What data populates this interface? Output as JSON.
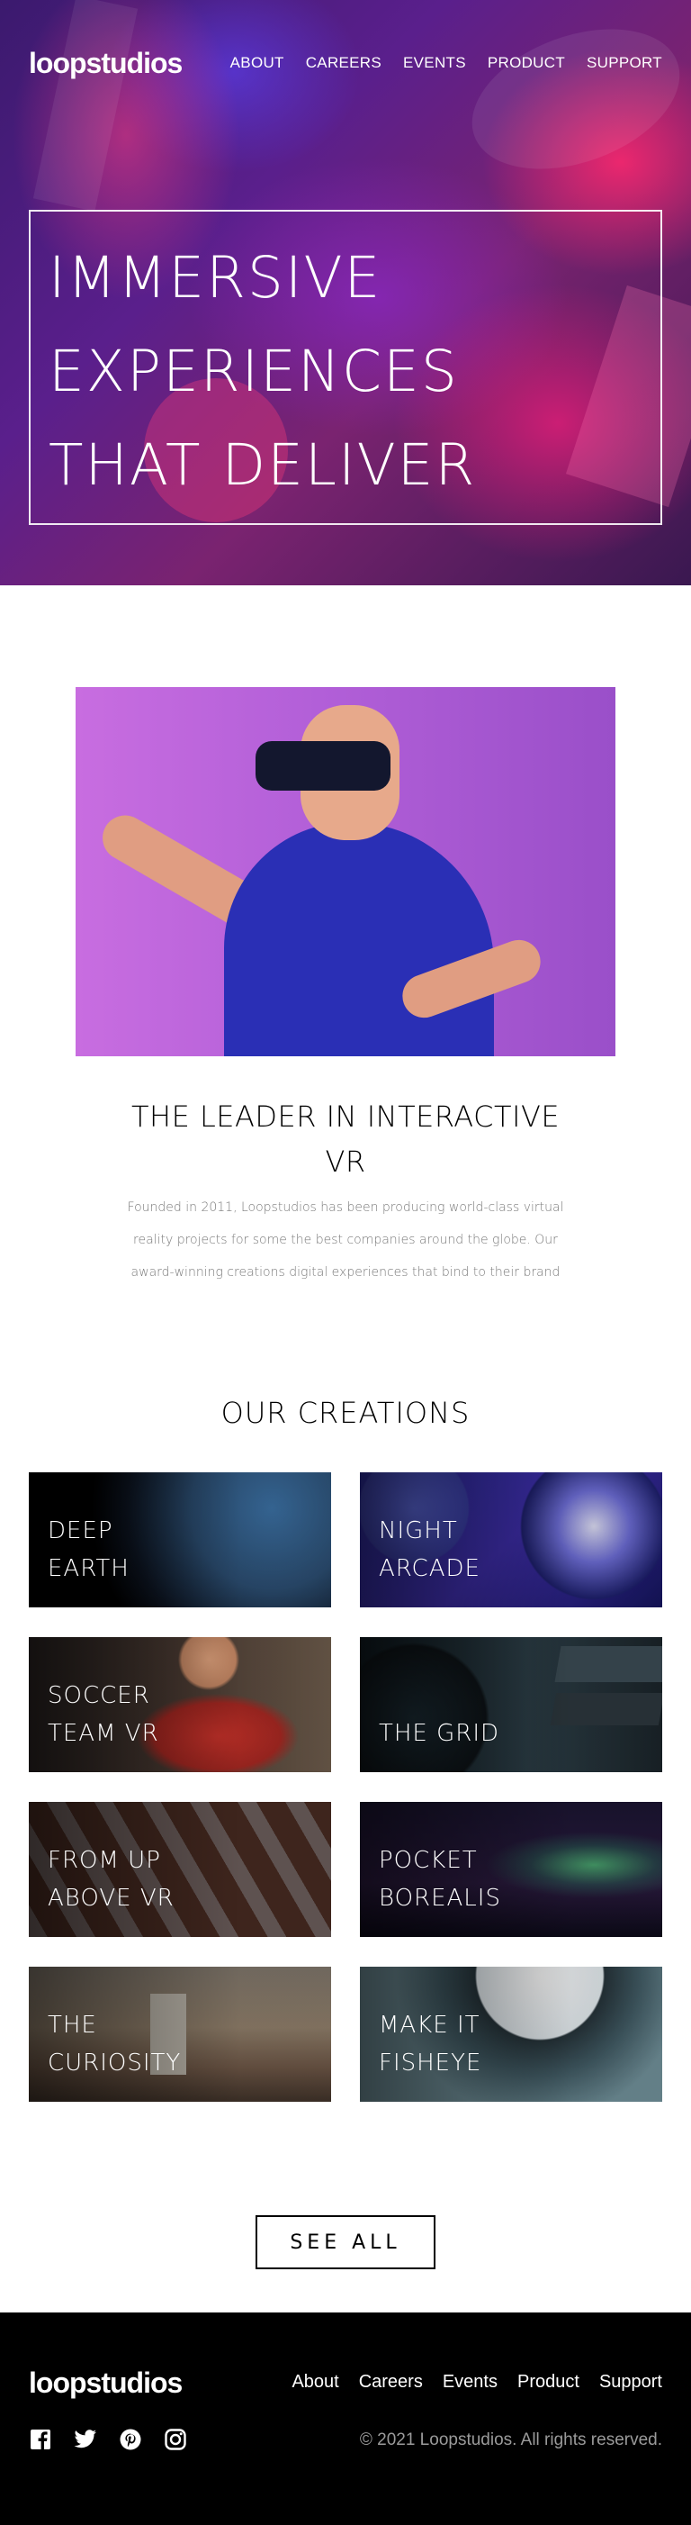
{
  "header": {
    "logo": "loopstudios",
    "nav": [
      "ABOUT",
      "CAREERS",
      "EVENTS",
      "PRODUCT",
      "SUPPORT"
    ]
  },
  "hero": {
    "title_lines": [
      "IMMERSIVE",
      "EXPERIENCES",
      "THAT DELIVER"
    ]
  },
  "intro": {
    "title": "THE LEADER IN INTERACTIVE VR",
    "text": "Founded in 2011, Loopstudios has been producing world-class virtual reality projects for some the best companies around the globe. Our award-winning creations digital experiences that bind to their brand"
  },
  "creations": {
    "title": "OUR CREATIONS",
    "items": [
      {
        "label": "DEEP\nEARTH"
      },
      {
        "label": "NIGHT\nARCADE"
      },
      {
        "label": "SOCCER\nTEAM VR"
      },
      {
        "label": "THE GRID"
      },
      {
        "label": "FROM UP\nABOVE VR"
      },
      {
        "label": "POCKET\nBOREALIS"
      },
      {
        "label": "THE\nCURIOSITY"
      },
      {
        "label": "MAKE IT\nFISHEYE"
      }
    ],
    "see_all": "SEE ALL"
  },
  "footer": {
    "logo": "loopstudios",
    "links": [
      "About",
      "Careers",
      "Events",
      "Product",
      "Support"
    ],
    "socials": [
      "facebook-icon",
      "twitter-icon",
      "pinterest-icon",
      "instagram-icon"
    ],
    "copyright": "© 2021 Loopstudios. All rights reserved."
  }
}
